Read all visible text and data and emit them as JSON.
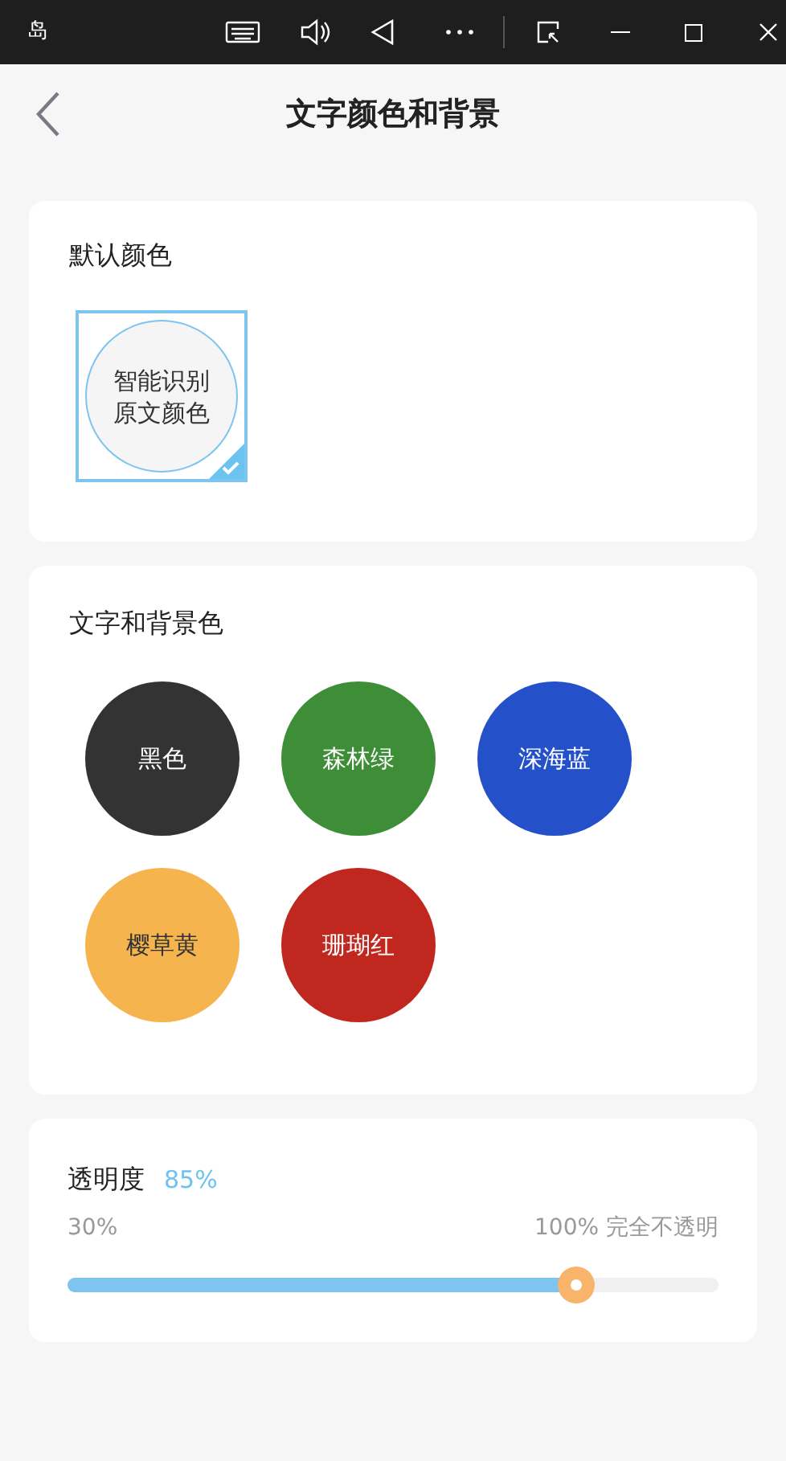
{
  "window": {
    "title": "岛"
  },
  "header": {
    "title": "文字颜色和背景"
  },
  "default_section": {
    "title": "默认颜色",
    "option": {
      "label_line1": "智能识别",
      "label_line2": "原文颜色",
      "selected": true
    }
  },
  "colors_section": {
    "title": "文字和背景色",
    "swatches": [
      {
        "label": "黑色",
        "color": "#333333",
        "selected": false
      },
      {
        "label": "森林绿",
        "color": "#3e8e37",
        "selected": false
      },
      {
        "label": "深海蓝",
        "color": "#2450c9",
        "selected": false
      },
      {
        "label": "樱草黄",
        "color": "#f6b44f",
        "selected": false
      },
      {
        "label": "珊瑚红",
        "color": "#c0281f",
        "selected": false
      }
    ]
  },
  "opacity": {
    "label": "透明度",
    "value": "85%",
    "min_label": "30%",
    "max_label": "100% 完全不透明",
    "level": 0.78
  }
}
